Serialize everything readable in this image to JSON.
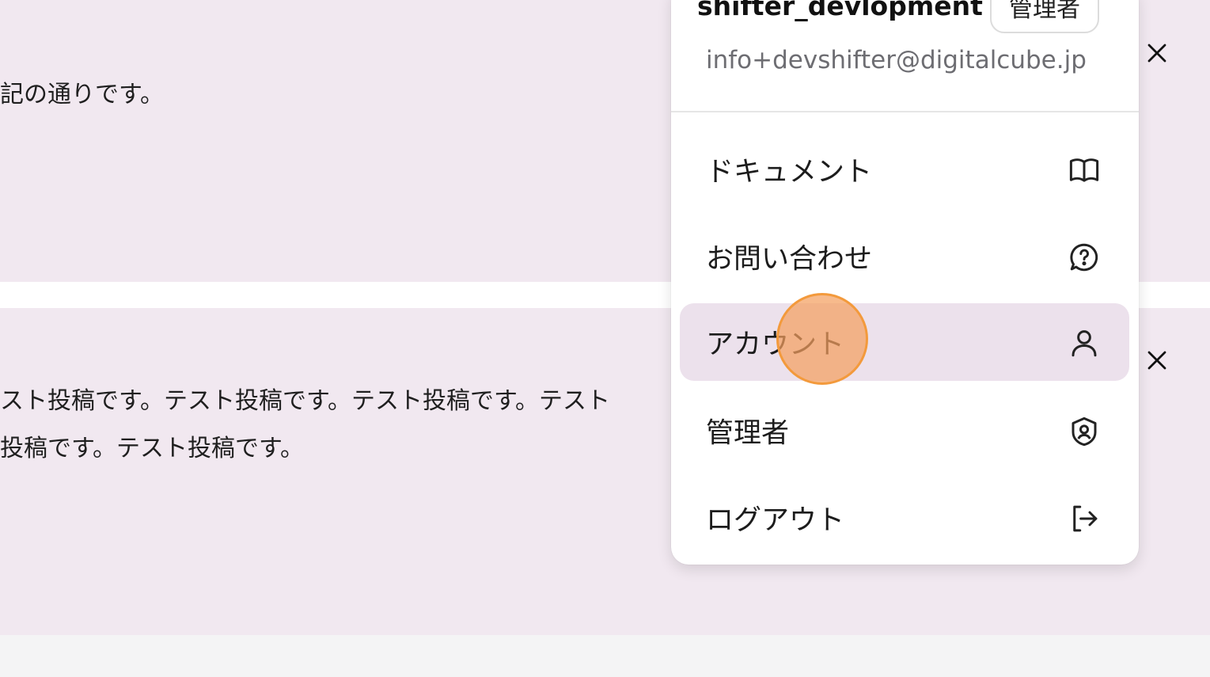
{
  "cards": [
    {
      "text": "記の通りです。"
    },
    {
      "lines": [
        "スト投稿です。テスト投稿です。テスト投稿です。テスト",
        "投稿です。テスト投稿です。"
      ]
    }
  ],
  "menu": {
    "username": "shifter_devlopment",
    "role_badge": "管理者",
    "email": "info+devshifter@digitalcube.jp",
    "items": [
      {
        "label": "ドキュメント",
        "icon": "book-open-icon"
      },
      {
        "label": "お問い合わせ",
        "icon": "question-circle-icon"
      },
      {
        "label": "アカウント",
        "icon": "user-icon",
        "active": true
      },
      {
        "label": "管理者",
        "icon": "shield-user-icon"
      },
      {
        "label": "ログアウト",
        "icon": "logout-icon"
      }
    ]
  },
  "colors": {
    "card_background": "#f1e8f0",
    "active_item_background": "#ece1ec",
    "email_text": "#6d6d72",
    "click_indicator": "#f39a3c"
  }
}
